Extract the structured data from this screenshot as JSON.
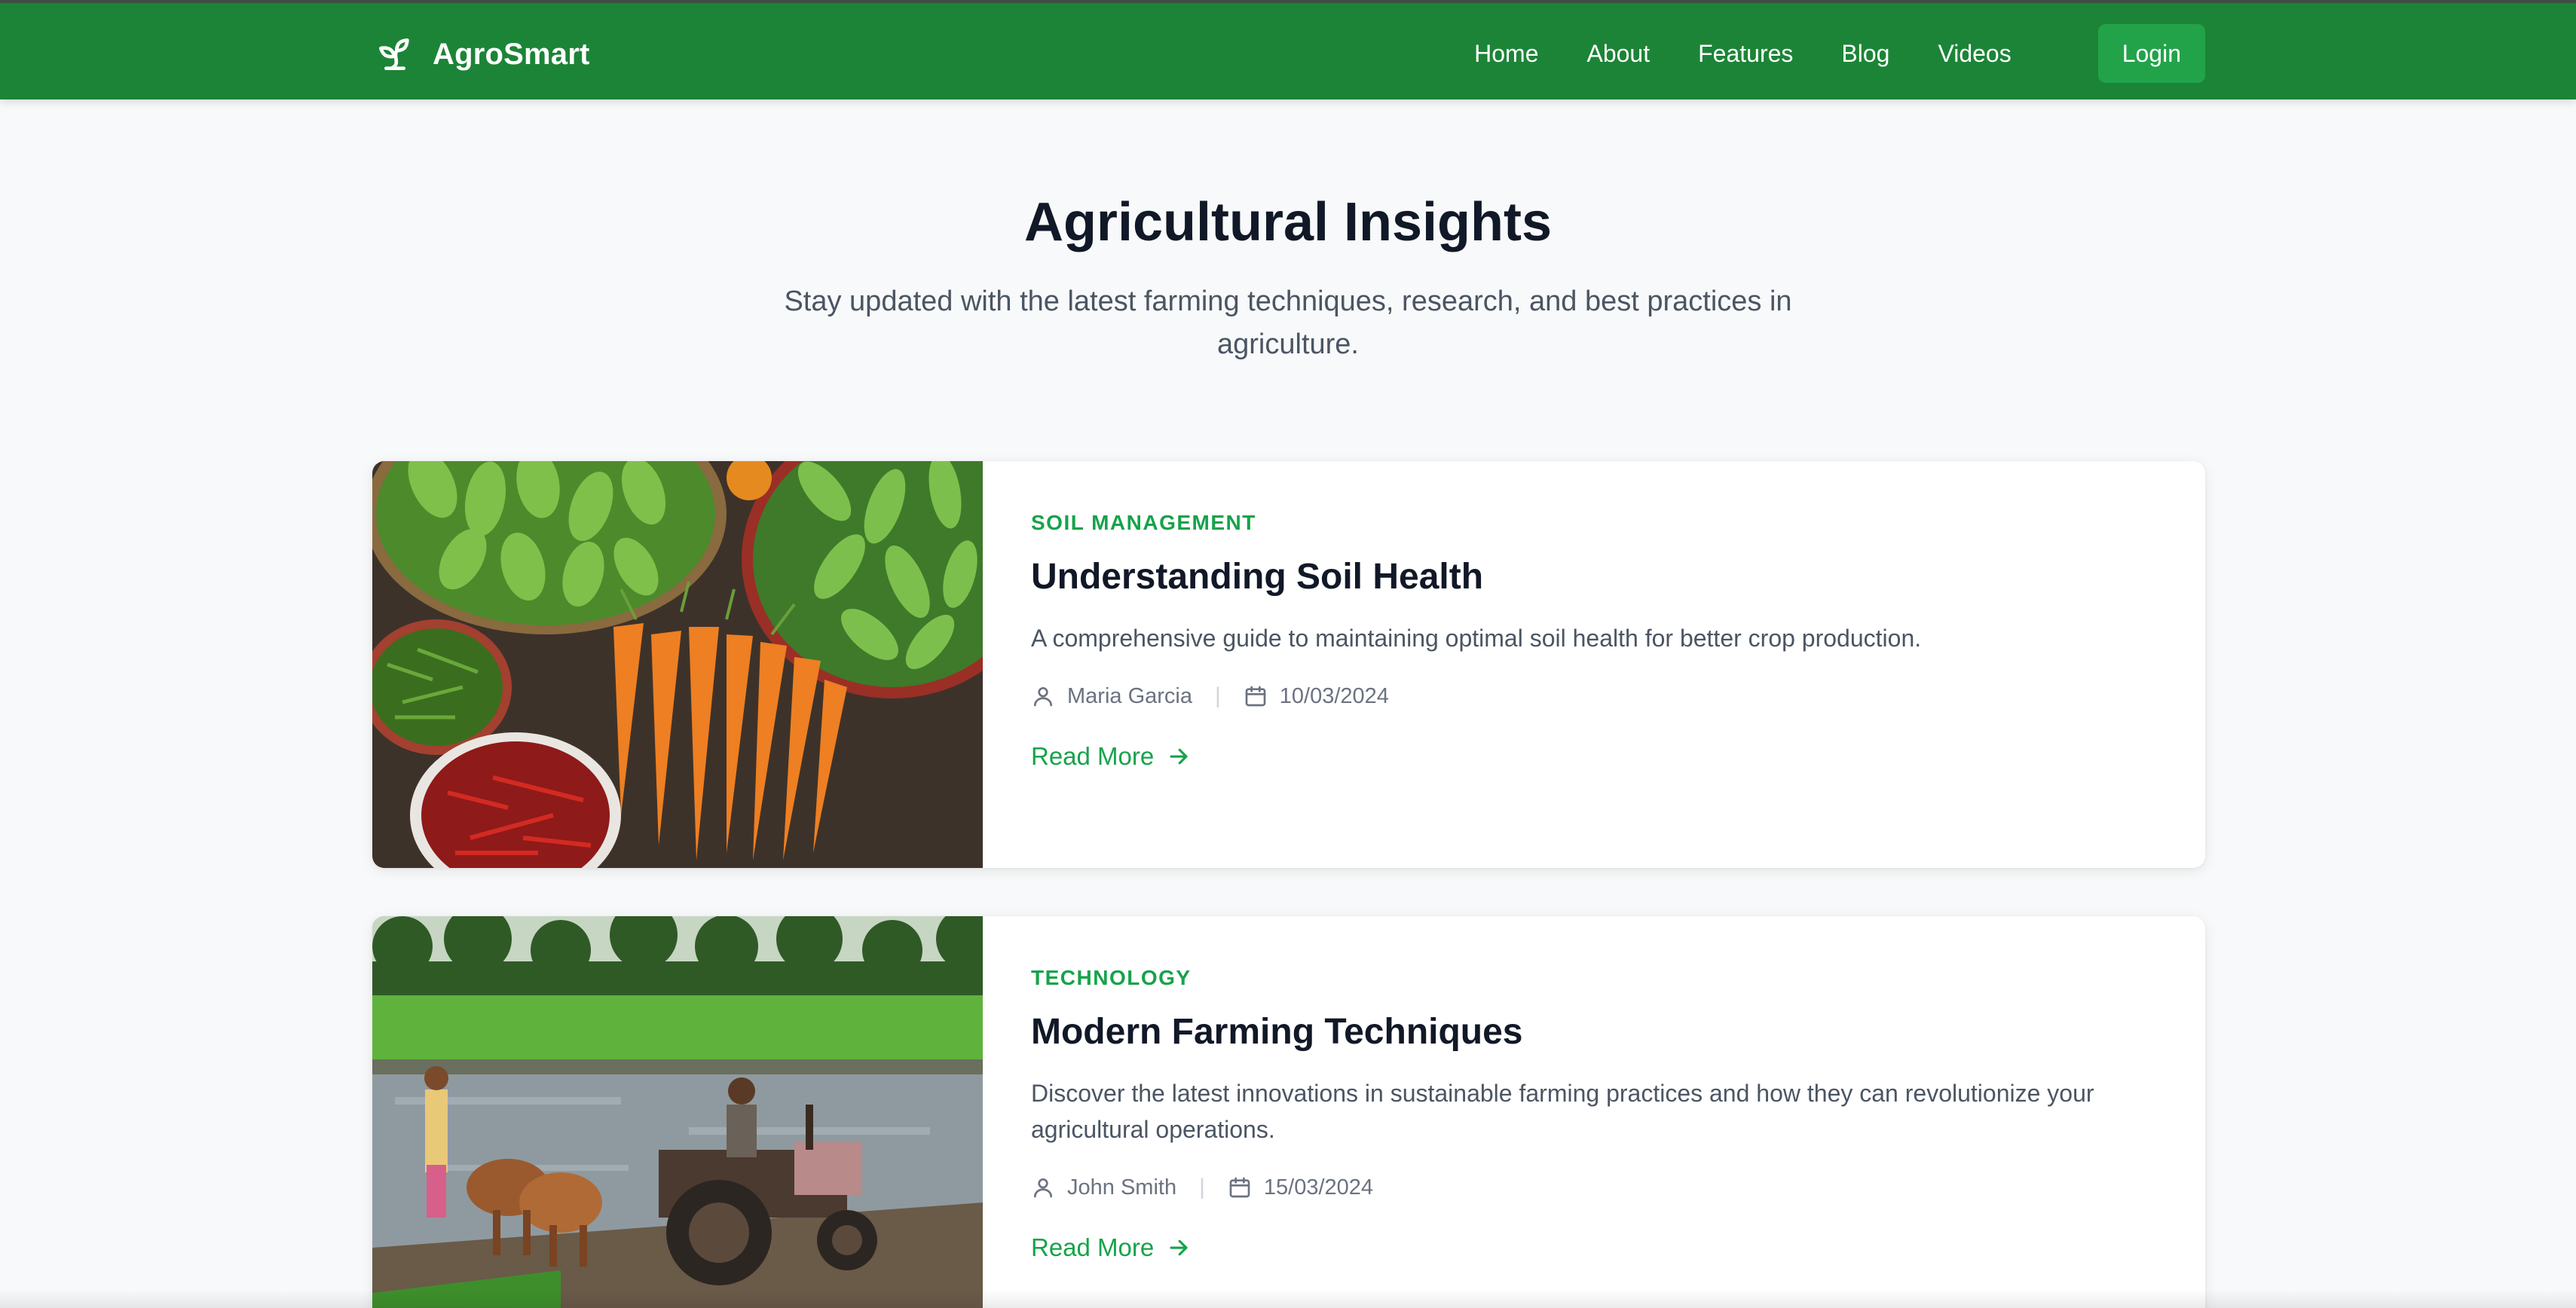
{
  "brand": {
    "name": "AgroSmart",
    "icon": "sprout-icon"
  },
  "nav": {
    "links": [
      "Home",
      "About",
      "Features",
      "Blog",
      "Videos"
    ],
    "login_label": "Login"
  },
  "hero": {
    "title": "Agricultural Insights",
    "subtitle": "Stay updated with the latest farming techniques, research, and best practices in agriculture."
  },
  "posts": [
    {
      "category": "SOIL MANAGEMENT",
      "title": "Understanding Soil Health",
      "excerpt": "A comprehensive guide to maintaining optimal soil health for better crop production.",
      "author": "Maria Garcia",
      "date": "10/03/2024",
      "read_more": "Read More",
      "image": "vegetables-market-photo"
    },
    {
      "category": "TECHNOLOGY",
      "title": "Modern Farming Techniques",
      "excerpt": "Discover the latest innovations in sustainable farming practices and how they can revolutionize your agricultural operations.",
      "author": "John Smith",
      "date": "15/03/2024",
      "read_more": "Read More",
      "image": "tractor-rice-field-photo"
    }
  ],
  "colors": {
    "nav_bg": "#1c8437",
    "accent": "#16a34a",
    "login_bg": "#22a34a",
    "page_bg": "#f8f9fa"
  }
}
